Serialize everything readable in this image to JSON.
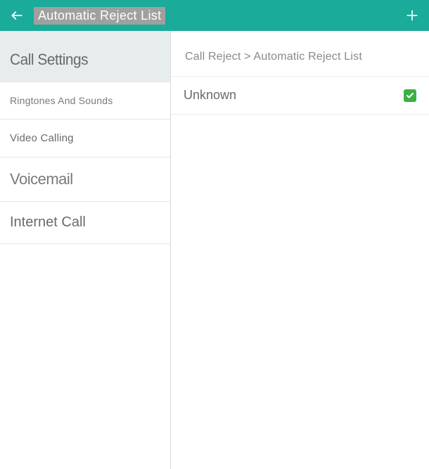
{
  "header": {
    "title": "Automatic Reject List"
  },
  "sidebar": {
    "items": [
      {
        "label": "Call Settings"
      },
      {
        "label": "Ringtones And Sounds"
      },
      {
        "label": "Video Calling"
      },
      {
        "label": "Voicemail"
      },
      {
        "label": "Internet Call"
      }
    ]
  },
  "breadcrumb": {
    "text": "Call Reject > Automatic Reject List"
  },
  "list": {
    "items": [
      {
        "label": "Unknown",
        "checked": true
      }
    ]
  },
  "colors": {
    "accent": "#1aab9b",
    "check": "#3cb043"
  }
}
